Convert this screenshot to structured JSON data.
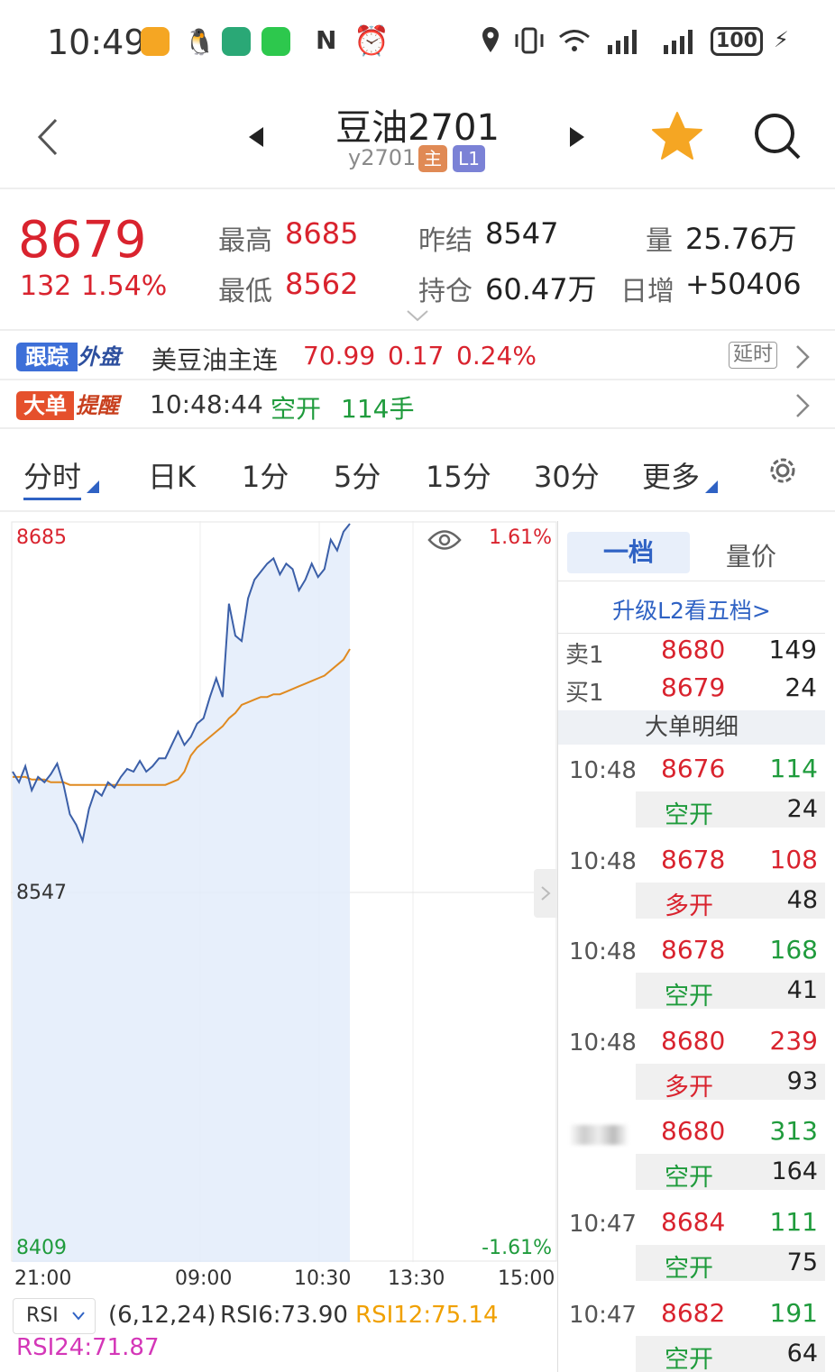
{
  "status_bar": {
    "time": "10:49",
    "battery": "100",
    "icons": [
      "app-orange-icon",
      "qq-icon",
      "green-app-icon",
      "wechat-icon",
      "nfc-icon",
      "alarm-icon",
      "location-icon",
      "vibrate-icon",
      "wifi-icon",
      "signal-icon",
      "signal2-icon",
      "battery-icon",
      "charging-icon"
    ]
  },
  "header": {
    "title": "豆油2701",
    "code": "y2701",
    "tag_main": "主",
    "tag_level": "L1",
    "colors": {
      "star": "#f5a623",
      "tag_main": "#e08a55",
      "tag_level": "#7b82d6"
    }
  },
  "quote": {
    "price": "8679",
    "change": "132",
    "change_pct": "1.54%",
    "high_label": "最高",
    "high": "8685",
    "low_label": "最低",
    "low": "8562",
    "prev_settle_label": "昨结",
    "prev_settle": "8547",
    "open_interest_label": "持仓",
    "open_interest": "60.47万",
    "volume_label": "量",
    "volume": "25.76万",
    "daily_inc_label": "日增",
    "daily_inc": "+50406"
  },
  "foreign": {
    "badge_left": "跟踪",
    "badge_right": "外盘",
    "name": "美豆油主连",
    "price": "70.99",
    "change": "0.17",
    "change_pct": "0.24%",
    "delay": "延时"
  },
  "big_order": {
    "badge_left": "大单",
    "badge_right": "提醒",
    "time": "10:48:44",
    "type": "空开",
    "qty": "114手"
  },
  "tabs": [
    "分时",
    "日K",
    "1分",
    "5分",
    "15分",
    "30分",
    "更多"
  ],
  "chart": {
    "y_top": "8685",
    "y_mid": "8547",
    "y_bottom": "8409",
    "pct_top": "1.61%",
    "pct_bottom": "-1.61%",
    "x_labels": [
      "21:00",
      "09:00",
      "10:30",
      "13:30",
      "15:00"
    ],
    "indicator": "RSI",
    "rsi_params": "(6,12,24)",
    "rsi6": "RSI6:73.90",
    "rsi12": "RSI12:75.14",
    "rsi24": "RSI24:71.87"
  },
  "chart_data": {
    "type": "line",
    "ylim": [
      8409,
      8685
    ],
    "reference": 8547,
    "series": [
      {
        "values": [
          8592,
          8588,
          8594,
          8585,
          8590,
          8588,
          8591,
          8595,
          8587,
          8576,
          8572,
          8566,
          8578,
          8585,
          8583,
          8588,
          8586,
          8590,
          8593,
          8592,
          8596,
          8592,
          8594,
          8597,
          8597,
          8602,
          8607,
          8602,
          8605,
          8610,
          8612,
          8620,
          8627,
          8620,
          8655,
          8643,
          8641,
          8657,
          8664,
          8667,
          8670,
          8672,
          8666,
          8670,
          8668,
          8660,
          8664,
          8670,
          8665,
          8668,
          8679,
          8675,
          8682,
          8685
        ]
      },
      {
        "values": [
          8590,
          8590,
          8590,
          8589,
          8589,
          8589,
          8588,
          8588,
          8588,
          8587,
          8587,
          8587,
          8587,
          8587,
          8587,
          8587,
          8587,
          8587,
          8587,
          8587,
          8587,
          8587,
          8587,
          8587,
          8587,
          8588,
          8589,
          8592,
          8598,
          8601,
          8603,
          8605,
          8607,
          8609,
          8612,
          8614,
          8617,
          8618,
          8619,
          8620,
          8620,
          8621,
          8621,
          8622,
          8623,
          8624,
          8625,
          8626,
          8627,
          8628,
          8630,
          8632,
          8634,
          8638
        ]
      }
    ]
  },
  "panel": {
    "tab_active": "一档",
    "tab_other": "量价",
    "upgrade": "升级L2看五档>",
    "ask_label": "卖1",
    "ask_price": "8680",
    "ask_qty": "149",
    "bid_label": "买1",
    "bid_price": "8679",
    "bid_qty": "24",
    "deals_title": "大单明细",
    "deals": [
      {
        "time": "10:48",
        "price": "8676",
        "vol": "114",
        "type": "空开",
        "qty": "24",
        "vol_color": "green",
        "type_color": "green"
      },
      {
        "time": "10:48",
        "price": "8678",
        "vol": "108",
        "type": "多开",
        "qty": "48",
        "vol_color": "red",
        "type_color": "red"
      },
      {
        "time": "10:48",
        "price": "8678",
        "vol": "168",
        "type": "空开",
        "qty": "41",
        "vol_color": "green",
        "type_color": "green"
      },
      {
        "time": "10:48",
        "price": "8680",
        "vol": "239",
        "type": "多开",
        "qty": "93",
        "vol_color": "red",
        "type_color": "red"
      },
      {
        "time": "",
        "price": "8680",
        "vol": "313",
        "type": "空开",
        "qty": "164",
        "vol_color": "green",
        "type_color": "green"
      },
      {
        "time": "10:47",
        "price": "8684",
        "vol": "111",
        "type": "空开",
        "qty": "75",
        "vol_color": "green",
        "type_color": "green"
      },
      {
        "time": "10:47",
        "price": "8682",
        "vol": "191",
        "type": "空开",
        "qty": "64",
        "vol_color": "green",
        "type_color": "green"
      }
    ]
  }
}
